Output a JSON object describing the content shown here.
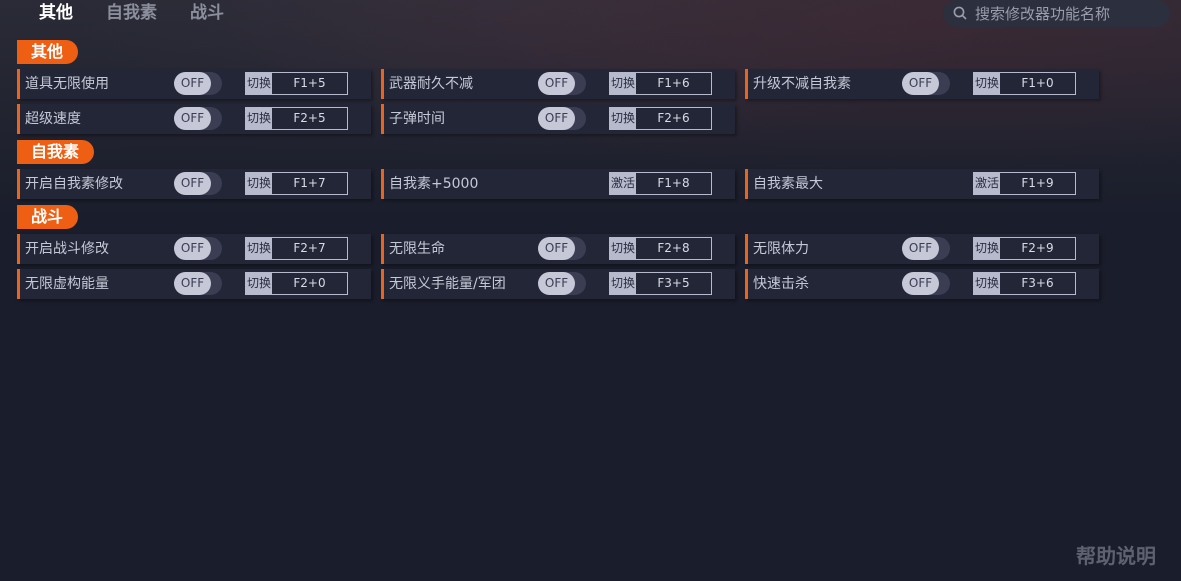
{
  "tabs": [
    "其他",
    "自我素",
    "战斗"
  ],
  "search": {
    "placeholder": "搜索修改器功能名称"
  },
  "sections": [
    {
      "title": "其他",
      "items": [
        {
          "label": "道具无限使用",
          "toggle": "OFF",
          "mode": "切换",
          "hotkey": "F1+5"
        },
        {
          "label": "武器耐久不减",
          "toggle": "OFF",
          "mode": "切换",
          "hotkey": "F1+6"
        },
        {
          "label": "升级不减自我素",
          "toggle": "OFF",
          "mode": "切换",
          "hotkey": "F1+0"
        },
        {
          "label": "超级速度",
          "toggle": "OFF",
          "mode": "切换",
          "hotkey": "F2+5"
        },
        {
          "label": "子弹时间",
          "toggle": "OFF",
          "mode": "切换",
          "hotkey": "F2+6"
        }
      ]
    },
    {
      "title": "自我素",
      "items": [
        {
          "label": "开启自我素修改",
          "toggle": "OFF",
          "mode": "切换",
          "hotkey": "F1+7"
        },
        {
          "label": "自我素+5000",
          "toggle": null,
          "mode": "激活",
          "hotkey": "F1+8"
        },
        {
          "label": "自我素最大",
          "toggle": null,
          "mode": "激活",
          "hotkey": "F1+9"
        }
      ]
    },
    {
      "title": "战斗",
      "items": [
        {
          "label": "开启战斗修改",
          "toggle": "OFF",
          "mode": "切换",
          "hotkey": "F2+7"
        },
        {
          "label": "无限生命",
          "toggle": "OFF",
          "mode": "切换",
          "hotkey": "F2+8"
        },
        {
          "label": "无限体力",
          "toggle": "OFF",
          "mode": "切换",
          "hotkey": "F2+9"
        },
        {
          "label": "无限虚构能量",
          "toggle": "OFF",
          "mode": "切换",
          "hotkey": "F2+0"
        },
        {
          "label": "无限义手能量/军团",
          "toggle": "OFF",
          "mode": "切换",
          "hotkey": "F3+5"
        },
        {
          "label": "快速击杀",
          "toggle": "OFF",
          "mode": "切换",
          "hotkey": "F3+6"
        }
      ]
    }
  ],
  "help_label": "帮助说明",
  "colors": {
    "accent": "#ee5f14",
    "row_bg": "#232637",
    "page_bg": "#1a1d2b"
  }
}
